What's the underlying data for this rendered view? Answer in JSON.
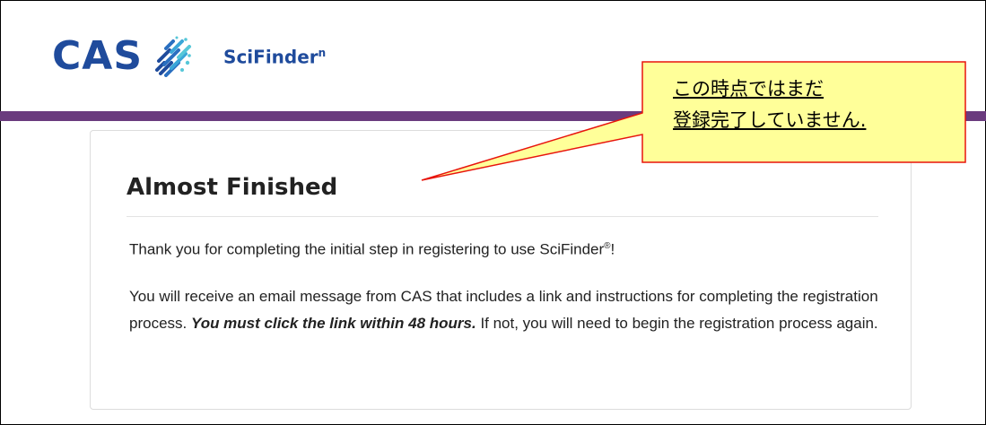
{
  "logo": {
    "cas_text": "CAS",
    "product_name": "SciFinder",
    "product_superscript": "n"
  },
  "card": {
    "title": "Almost Finished",
    "para1_text": "Thank you for completing the initial step in registering to use SciFinder",
    "para1_reg_mark": "®",
    "para1_end": "!",
    "para2_start": "You will receive an email message from CAS that includes a link and instructions for completing the registration process.",
    "para2_emphasis": "You must click the link within 48 hours.",
    "para2_end": "If not, you will need to begin the registration process again."
  },
  "callout": {
    "line1": "この時点ではまだ",
    "line2": "登録完了していません.",
    "fill_color": "#ffff99",
    "border_color": "#e8140c"
  },
  "colors": {
    "brand_blue": "#1f4b9c",
    "accent_purple": "#6a3b7e"
  },
  "icons": {
    "logo_mark": "cas-molecule-logo-icon"
  }
}
